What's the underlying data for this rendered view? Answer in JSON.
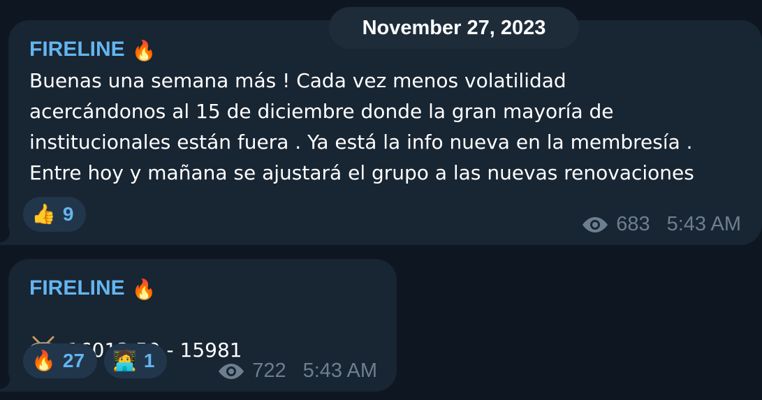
{
  "date_separator": "November 27, 2023",
  "messages": [
    {
      "author": "FIRELINE",
      "author_emoji": "🔥",
      "text": "Buenas una semana más ! Cada vez menos volatilidad\nacercándonos al 15 de diciembre donde la gran mayoría de\ninstitucionales están fuera . Ya está la info nueva en la membresía .\nEntre hoy y mañana se ajustará el grupo a las nuevas renovaciones",
      "reactions": [
        {
          "emoji": "👍",
          "count": "9"
        }
      ],
      "views": "683",
      "time": "5:43 AM"
    },
    {
      "author": "FIRELINE",
      "author_emoji": "🔥",
      "text": "16013.50 - 15981",
      "leading_icon": "drum-icon",
      "reactions": [
        {
          "emoji": "🔥",
          "count": "27"
        },
        {
          "emoji": "🧑‍💻",
          "count": "1"
        }
      ],
      "views": "722",
      "time": "5:43 AM"
    }
  ],
  "colors": {
    "background": "#0e1621",
    "bubble": "#182533",
    "author": "#64b5ef",
    "meta": "#6d7f8f",
    "reaction_bg": "#22364b"
  }
}
